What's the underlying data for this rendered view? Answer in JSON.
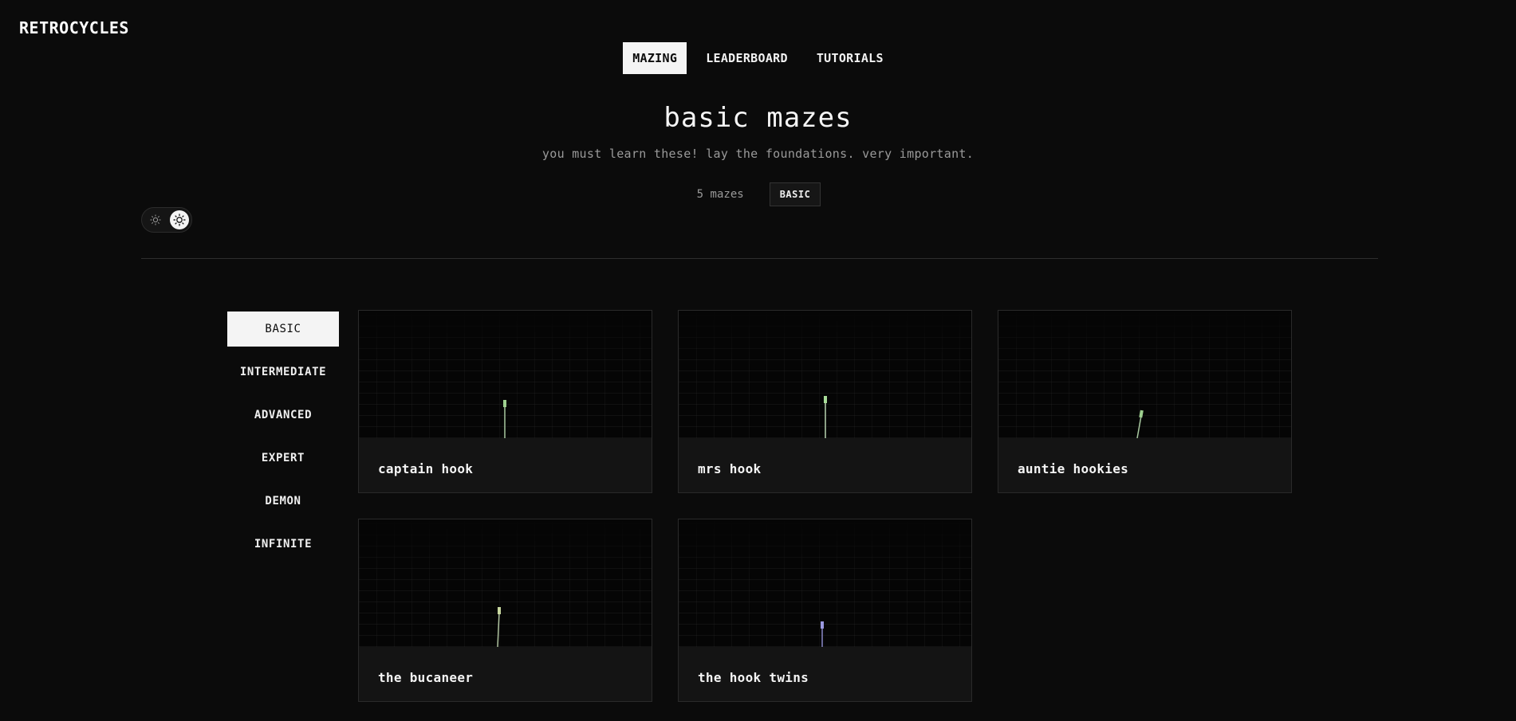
{
  "brand": "RETROCYCLES",
  "nav": {
    "tabs": [
      {
        "label": "MAZING",
        "active": true
      },
      {
        "label": "LEADERBOARD",
        "active": false
      },
      {
        "label": "TUTORIALS",
        "active": false
      }
    ]
  },
  "header": {
    "title": "basic mazes",
    "subtitle": "you must learn these! lay the foundations. very important.",
    "count": "5 mazes",
    "badge": "BASIC"
  },
  "sidebar": {
    "items": [
      {
        "label": "BASIC",
        "active": true
      },
      {
        "label": "INTERMEDIATE",
        "active": false
      },
      {
        "label": "ADVANCED",
        "active": false
      },
      {
        "label": "EXPERT",
        "active": false
      },
      {
        "label": "DEMON",
        "active": false
      },
      {
        "label": "INFINITE",
        "active": false
      }
    ]
  },
  "mazes": [
    {
      "title": "captain hook",
      "trail_color": "#a8c8a0"
    },
    {
      "title": "mrs hook",
      "trail_color": "#b8d4b0"
    },
    {
      "title": "auntie hookies",
      "trail_color": "#a8c8a0"
    },
    {
      "title": "the bucaneer",
      "trail_color": "#b0c4a0"
    },
    {
      "title": "the hook twins",
      "trail_color": "#8a88c8"
    }
  ],
  "colors": {
    "background": "#0b0b0b",
    "active_bg": "#f4f4f4",
    "card_bg": "#141414"
  },
  "icons": {
    "theme_dim": "sun-small-icon",
    "theme_on": "sun-icon"
  }
}
